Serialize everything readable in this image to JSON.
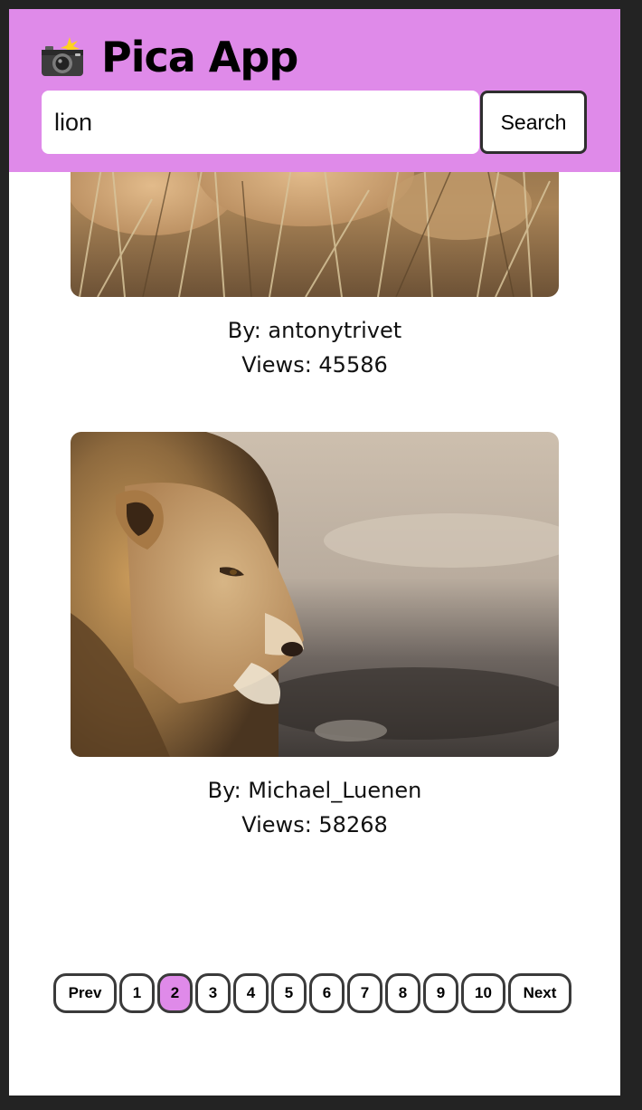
{
  "header": {
    "title": "Pica App",
    "icon": "camera-flash-icon",
    "accent_color": "#df8ae9"
  },
  "search": {
    "value": "lion",
    "button_label": "Search"
  },
  "results": [
    {
      "author": "By: antonytrivet",
      "views": "Views: 45586",
      "image": "lion-paws-in-dry-grass"
    },
    {
      "author": "By: Michael_Luenen",
      "views": "Views: 58268",
      "image": "male-lion-profile"
    }
  ],
  "pagination": {
    "prev_label": "Prev",
    "next_label": "Next",
    "pages": [
      "1",
      "2",
      "3",
      "4",
      "5",
      "6",
      "7",
      "8",
      "9",
      "10"
    ],
    "current_page": "2"
  }
}
